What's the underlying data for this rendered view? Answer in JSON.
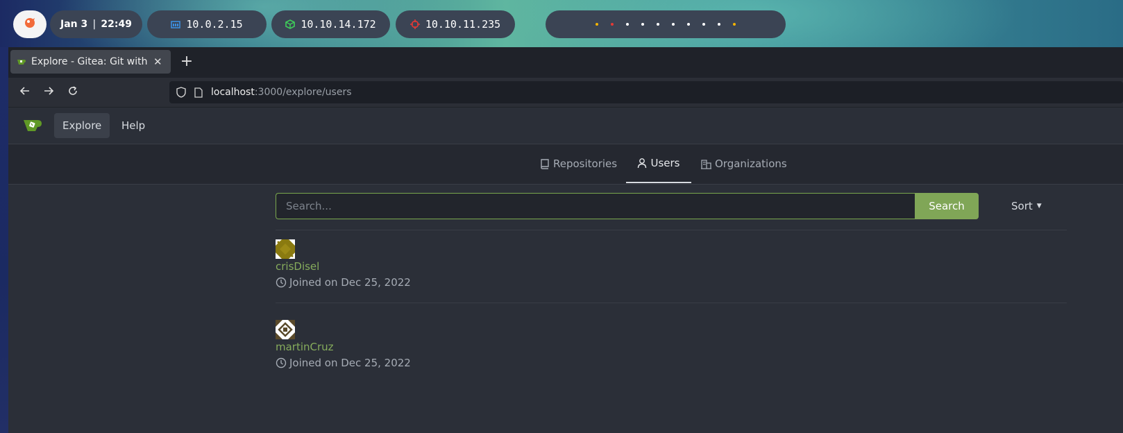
{
  "taskbar": {
    "date": "Jan 3",
    "time": "22:49",
    "ip_local": "10.0.2.15",
    "ip_vpn": "10.10.14.172",
    "ip_target": "10.10.11.235",
    "dot_colors": [
      "#f5b400",
      "#e53935",
      "#ffffff",
      "#ffffff",
      "#ffffff",
      "#ffffff",
      "#ffffff",
      "#ffffff",
      "#ffffff",
      "#f5b400"
    ]
  },
  "browser": {
    "tab_title": "Explore - Gitea: Git with a",
    "url_host": "localhost",
    "url_path": ":3000/explore/users"
  },
  "gitea_nav": {
    "explore": "Explore",
    "help": "Help"
  },
  "explore_tabs": {
    "repositories": "Repositories",
    "users": "Users",
    "organizations": "Organizations"
  },
  "search": {
    "placeholder": "Search...",
    "button": "Search",
    "sort": "Sort"
  },
  "users": [
    {
      "name": "crisDisel",
      "joined": "Joined on Dec 25, 2022"
    },
    {
      "name": "martinCruz",
      "joined": "Joined on Dec 25, 2022"
    }
  ],
  "colors": {
    "accent": "#80a657",
    "link": "#86ac5c",
    "page_bg": "#2b2f38"
  }
}
